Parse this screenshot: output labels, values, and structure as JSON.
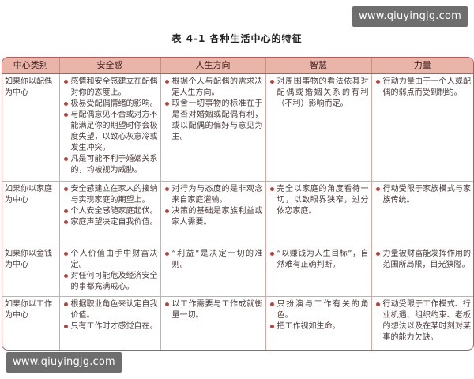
{
  "watermark_top": "www.qiuyingjg.com",
  "watermark_bottom": "www.qiuyingjg.com",
  "table_title": "表 4-1   各种生活中心的特征",
  "headers": [
    "中心类别",
    "安全感",
    "人生方向",
    "智慧",
    "力量"
  ],
  "rows": [
    {
      "category": "如果你以配偶为中心",
      "cells": [
        [
          "感情和安全感建立在配偶对你的态度上。",
          "极易受配偶情绪的影响。",
          "与配偶意见不合或对方不能满足你的期望时你会极度失望，以致心灰意冷或发生冲突。",
          "凡是可能不利于婚姻关系的，均被视为威胁。"
        ],
        [
          "根据个人与配偶的需求决定人生方向。",
          "取舍一切事物的标准在于是否对婚姻或配偶有利，或以配偶的偏好与意见为主。"
        ],
        [
          "对周围事物的看法依其对配偶或婚姻关系的有利（不利）影响而定。"
        ],
        [
          "行动力量由于一个人或配偶的弱点而受到制约。"
        ]
      ]
    },
    {
      "category": "如果你以家庭为中心",
      "cells": [
        [
          "安全感建立在家人的接纳与实现家庭的期望上。",
          "个人安全感随家庭起伏。",
          "家庭声望决定自我价值。"
        ],
        [
          "对行为与态度的是非观念来自家庭灌输。",
          "决策的基础是家族利益或家人需要。"
        ],
        [
          "完全以家庭的角度看待一切，以致眼界狭窄，过分依恋家庭。"
        ],
        [
          "行动受限于家族模式与家族传统。"
        ]
      ]
    },
    {
      "category": "如果你以金钱为中心",
      "cells": [
        [
          "个人价值由手中财富决定。",
          "对任何可能危及经济安全的事都充满戒心。"
        ],
        [
          "“利益”是决定一切的准则。"
        ],
        [
          "“以赚钱为人生目标”，自然难有正确判断。"
        ],
        [
          "力量被财富能发挥作用的范围所局限，目光狭隘。"
        ]
      ]
    },
    {
      "category": "如果你以工作为中心",
      "cells": [
        [
          "根据职业角色来认定自我价值。",
          "只有工作时才感觉自在。"
        ],
        [
          "以工作需要与工作成就衡量一切。"
        ],
        [
          "只扮演与工作有关的角色。",
          "把工作视如生命。"
        ],
        [
          "行动受限于工作模式、行业机遇、组织约束、老板的想法以及在某时刻对某事的能力欠缺。"
        ]
      ]
    }
  ]
}
